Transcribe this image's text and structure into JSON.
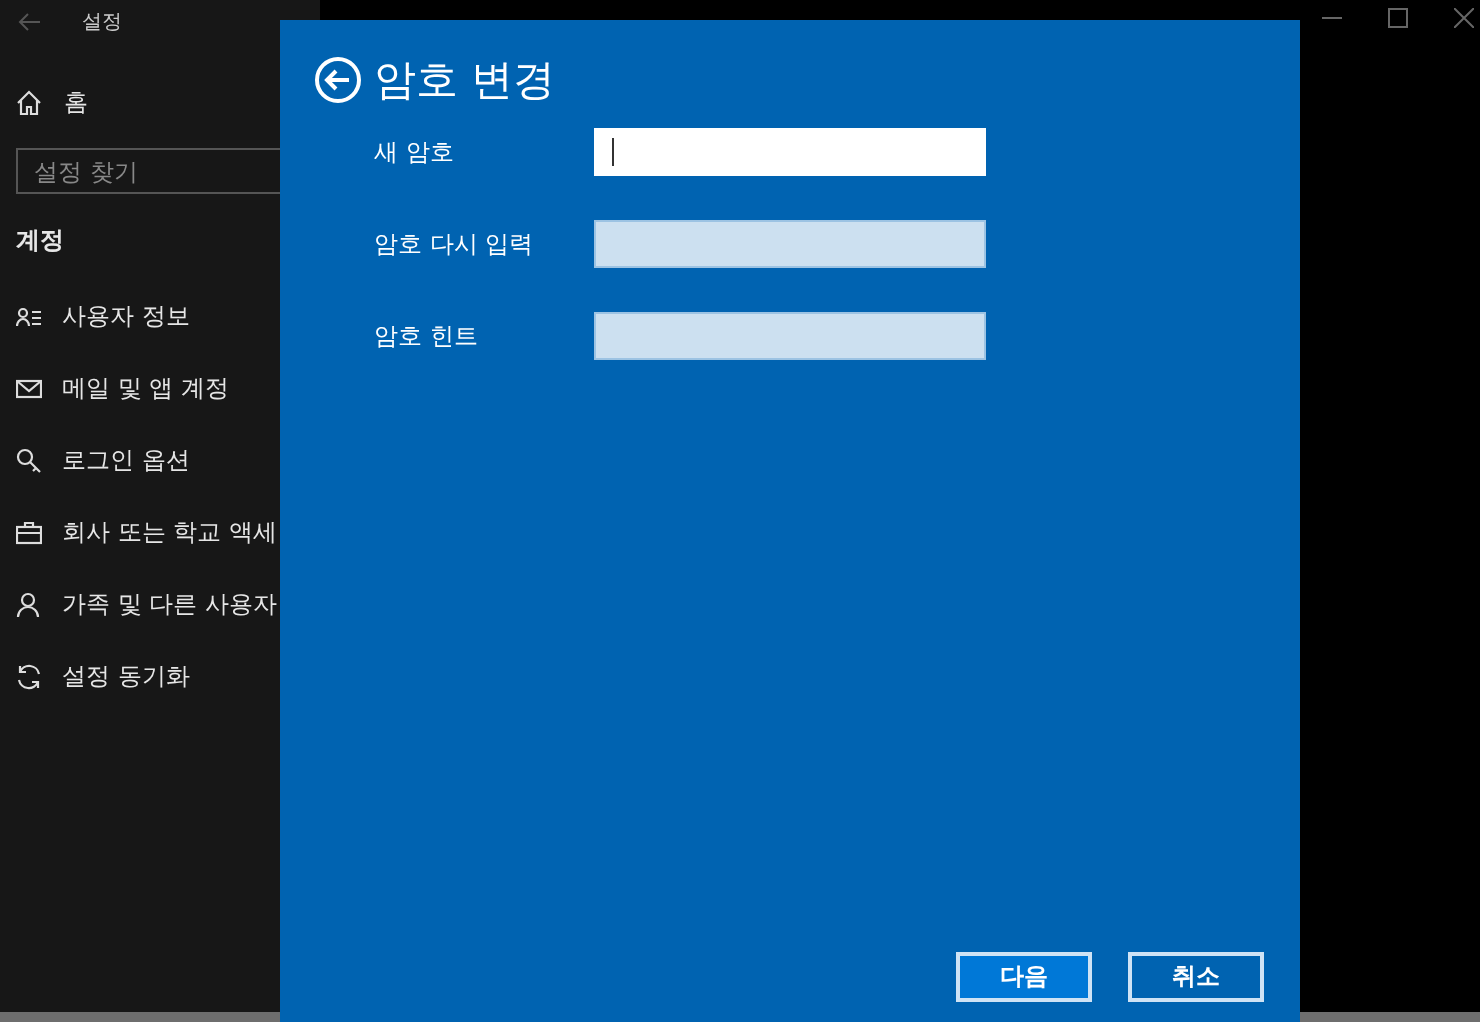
{
  "window": {
    "title": "설정"
  },
  "sidebar": {
    "home": "홈",
    "search": {
      "placeholder": "설정 찾기"
    },
    "section": "계정",
    "items": [
      {
        "label": "사용자 정보"
      },
      {
        "label": "메일 및 앱 계정"
      },
      {
        "label": "로그인 옵션"
      },
      {
        "label": "회사 또는 학교 액세"
      },
      {
        "label": "가족 및 다른 사용자"
      },
      {
        "label": "설정 동기화"
      }
    ]
  },
  "dialog": {
    "title": "암호 변경",
    "fields": [
      {
        "label": "새 암호",
        "focused": true
      },
      {
        "label": "암호 다시 입력",
        "focused": false
      },
      {
        "label": "암호 힌트",
        "focused": false
      }
    ],
    "buttons": [
      {
        "label": "다음",
        "primary": true
      },
      {
        "label": "취소",
        "primary": false
      }
    ]
  }
}
